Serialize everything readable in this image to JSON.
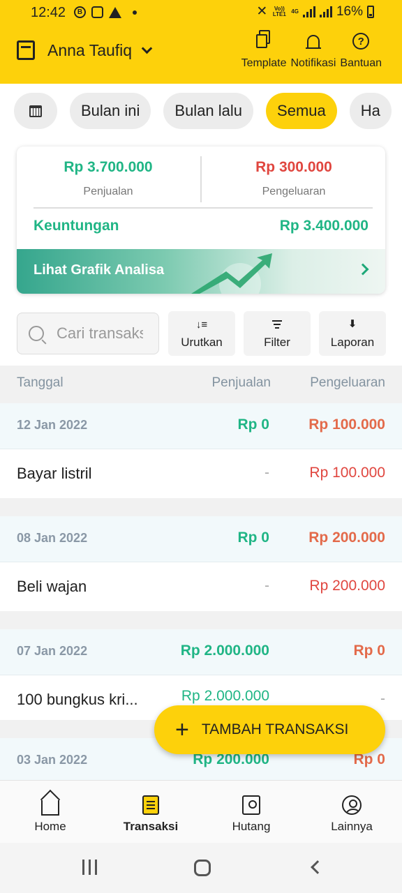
{
  "status_bar": {
    "time": "12:42",
    "left_icons": [
      "b-icon",
      "instagram-icon",
      "warning-icon",
      "dot"
    ],
    "network_top": "Vo)) LTE1",
    "network_4g": "4G",
    "battery": "16%"
  },
  "header": {
    "business_name": "Anna Taufiq",
    "actions": [
      {
        "label": "Template",
        "icon": "template-icon"
      },
      {
        "label": "Notifikasi",
        "icon": "bell-icon"
      },
      {
        "label": "Bantuan",
        "icon": "help-icon"
      }
    ]
  },
  "chips": {
    "items": [
      "Bulan ini",
      "Bulan lalu",
      "Semua",
      "Ha"
    ],
    "active": "Semua"
  },
  "summary": {
    "sales_value": "Rp 3.700.000",
    "sales_label": "Penjualan",
    "expense_value": "Rp 300.000",
    "expense_label": "Pengeluaran",
    "profit_label": "Keuntungan",
    "profit_value": "Rp 3.400.000",
    "analysis_label": "Lihat Grafik Analisa"
  },
  "toolbar": {
    "search_placeholder": "Cari transaksi",
    "sort_label": "Urutkan",
    "filter_label": "Filter",
    "report_label": "Laporan"
  },
  "table": {
    "headers": [
      "Tanggal",
      "Penjualan",
      "Pengeluaran"
    ],
    "groups": [
      {
        "date": "12 Jan 2022",
        "sales": "Rp 0",
        "expense": "Rp 100.000",
        "rows": [
          {
            "name": "Bayar listril",
            "sales": "-",
            "expense": "Rp 100.000"
          }
        ]
      },
      {
        "date": "08 Jan 2022",
        "sales": "Rp 0",
        "expense": "Rp 200.000",
        "rows": [
          {
            "name": "Beli wajan",
            "sales": "-",
            "expense": "Rp 200.000"
          }
        ]
      },
      {
        "date": "07 Jan 2022",
        "sales": "Rp 2.000.000",
        "expense": "Rp 0",
        "rows": [
          {
            "name": "100 bungkus kri...",
            "sales": "Rp 2.000.000",
            "expense": "-"
          }
        ]
      },
      {
        "date": "03 Jan 2022",
        "sales": "Rp 200.000",
        "expense": "Rp 0",
        "rows": []
      }
    ]
  },
  "fab": {
    "label": "TAMBAH TRANSAKSI"
  },
  "bottom_nav": {
    "items": [
      {
        "label": "Home",
        "icon": "home-icon"
      },
      {
        "label": "Transaksi",
        "icon": "transaction-icon"
      },
      {
        "label": "Hutang",
        "icon": "debt-icon"
      },
      {
        "label": "Lainnya",
        "icon": "user-icon"
      }
    ],
    "active": "Transaksi"
  },
  "colors": {
    "brand_yellow": "#fdd10b",
    "sales_green": "#20b585",
    "expense_red": "#e0463f",
    "expense_orange": "#e36a4a"
  }
}
